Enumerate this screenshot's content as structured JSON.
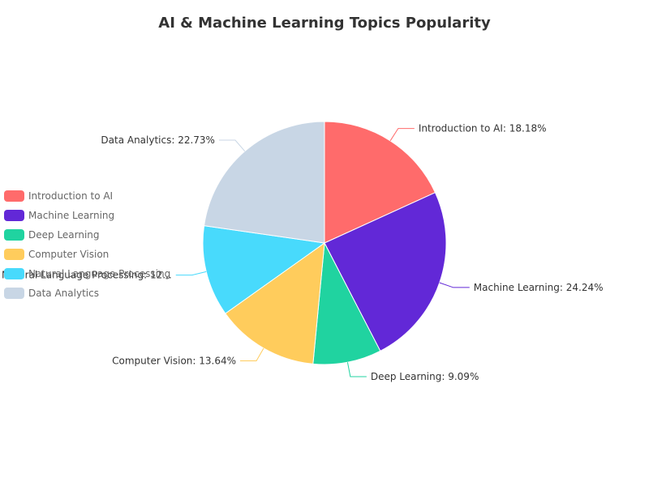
{
  "chart_data": {
    "type": "pie",
    "title": "AI & Machine Learning Topics Popularity",
    "categories": [
      "Introduction to AI",
      "Machine Learning",
      "Deep Learning",
      "Computer Vision",
      "Natural Language Processing",
      "Data Analytics"
    ],
    "values": [
      18.18,
      24.24,
      9.09,
      13.64,
      12.12,
      22.73
    ],
    "slice_labels": [
      "Introduction to AI: 18.18%",
      "Machine Learning: 24.24%",
      "Deep Learning: 9.09%",
      "Computer Vision: 13.64%",
      "Natural Language Processing: 12...",
      "Data Analytics: 22.73%"
    ],
    "colors": [
      "#FF6B6B",
      "#6228D7",
      "#20D3A0",
      "#FFCC5C",
      "#48DAFC",
      "#C8D6E5"
    ],
    "legend_position": "left"
  }
}
